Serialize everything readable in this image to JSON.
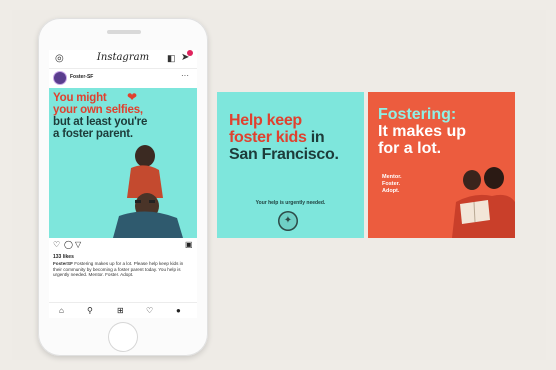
{
  "instagram": {
    "logo": "Instagram",
    "username": "Foster-SF",
    "likes": "133 likes",
    "caption_user": "FosterSF",
    "caption_text": "Fostering makes up for a lot. Please help keep kids in their community by becoming a foster parent today. You help is urgently needed.",
    "caption_tail": "Mentor. Foster. Adopt."
  },
  "post_headline": {
    "line1": "You might",
    "line2": "your own selfies,",
    "line3": "but at least you're",
    "line4": "a foster parent."
  },
  "card_help": {
    "line1": "Help keep",
    "line2a": "foster kids",
    "line2b": " in",
    "line3": "San Francisco.",
    "tagline": "Your help is urgently needed."
  },
  "card_fostering": {
    "line1": "Fostering:",
    "line2": "It makes up",
    "line3": "for a lot.",
    "m1": "Mentor.",
    "m2": "Foster.",
    "m3": "Adopt."
  },
  "colors": {
    "teal": "#7ee6dc",
    "coral": "#ec5c3e",
    "heart": "#e0412f",
    "dark": "#1d3c3a"
  },
  "icons": [
    "camera-icon",
    "igtv-icon",
    "direct-message-icon",
    "heart-icon",
    "comment-icon",
    "share-icon",
    "bookmark-icon",
    "home-icon",
    "search-icon",
    "add-post-icon",
    "activity-icon",
    "profile-icon",
    "city-seal-icon"
  ]
}
